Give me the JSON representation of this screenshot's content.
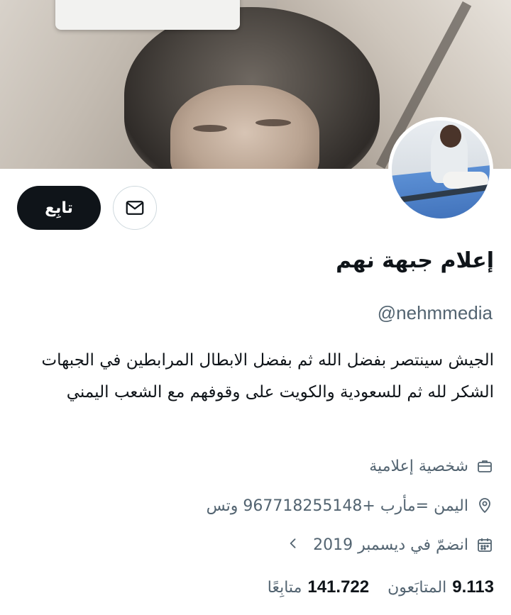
{
  "profile": {
    "display_name": "إعلام جبهة نهم",
    "handle": "@nehmmedia",
    "bio": "الجيش سينتصر بفضل الله ثم بفضل الابطال المرابطين في الجبهات الشكر لله ثم للسعودية والكويت على وقوفهم مع الشعب اليمني",
    "category": "شخصية إعلامية",
    "location": "اليمن =مأرب +967718255148  وتس",
    "joined": "انضمّ في ديسمبر 2019"
  },
  "actions": {
    "follow_label": "تابِع",
    "message_icon": "mail-icon"
  },
  "stats": {
    "followers_count": "9.113",
    "followers_label": "المتابَعون",
    "following_count": "141.722",
    "following_label": "متابِعًا"
  },
  "icons": {
    "category": "briefcase-icon",
    "location": "location-pin-icon",
    "joined": "calendar-icon",
    "chevron": "chevron-left-icon"
  },
  "colors": {
    "primary_text": "#0f1419",
    "secondary_text": "#536471",
    "follow_button_bg": "#0f1419",
    "border": "#cfd9de"
  }
}
